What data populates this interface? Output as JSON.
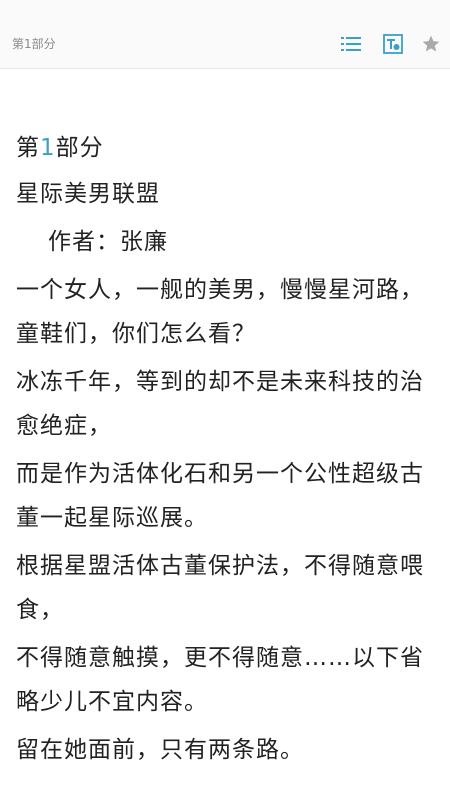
{
  "header": {
    "breadcrumb": "第1部分",
    "icons": [
      "list-icon",
      "font-settings-icon",
      "star-icon"
    ],
    "accent_color": "#3aa0c8",
    "star_color": "#aaaaaa"
  },
  "content": {
    "chapter_prefix": "第",
    "chapter_number": "1",
    "chapter_suffix": "部分",
    "book_title": "星际美男联盟",
    "author_line": "作者：张廉",
    "paragraphs": [
      "一个女人，一舰的美男，慢慢星河路，童鞋们，你们怎么看？",
      "冰冻千年，等到的却不是未来科技的治愈绝症，",
      "而是作为活体化石和另一个公性超级古董一起星际巡展。",
      "根据星盟活体古董保护法，不得随意喂食，",
      "不得随意触摸，更不得随意……以下省略少儿不宜内容。",
      "留在她面前，只有两条路。"
    ]
  }
}
